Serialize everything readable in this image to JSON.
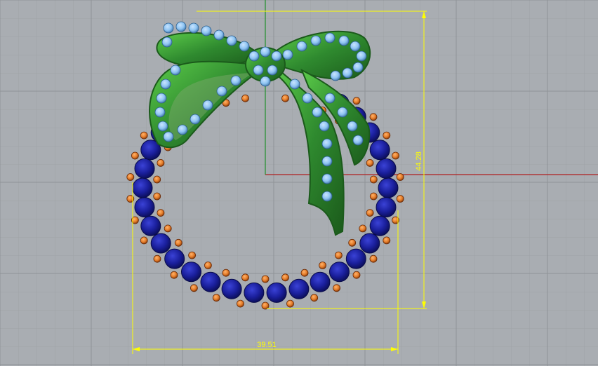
{
  "viewport": {
    "background": "#a9adb2",
    "grid_minor_color": "#9ea2a7",
    "grid_major_color": "#8f9398",
    "axis_x_color": "#b02020",
    "axis_y_color": "#1f8f2a"
  },
  "dimensions": {
    "width_label": "39.51",
    "height_label": "44.28",
    "color": "#ffff00"
  },
  "model": {
    "ring_stone_color": "#1a1f9c",
    "ring_stone_highlight": "#2c33c7",
    "accent_stone_color": "#e57d2a",
    "bow_color": "#2f8a2f",
    "bow_highlight": "#5ccc4a",
    "bow_stone_color": "#8ec4f2"
  }
}
